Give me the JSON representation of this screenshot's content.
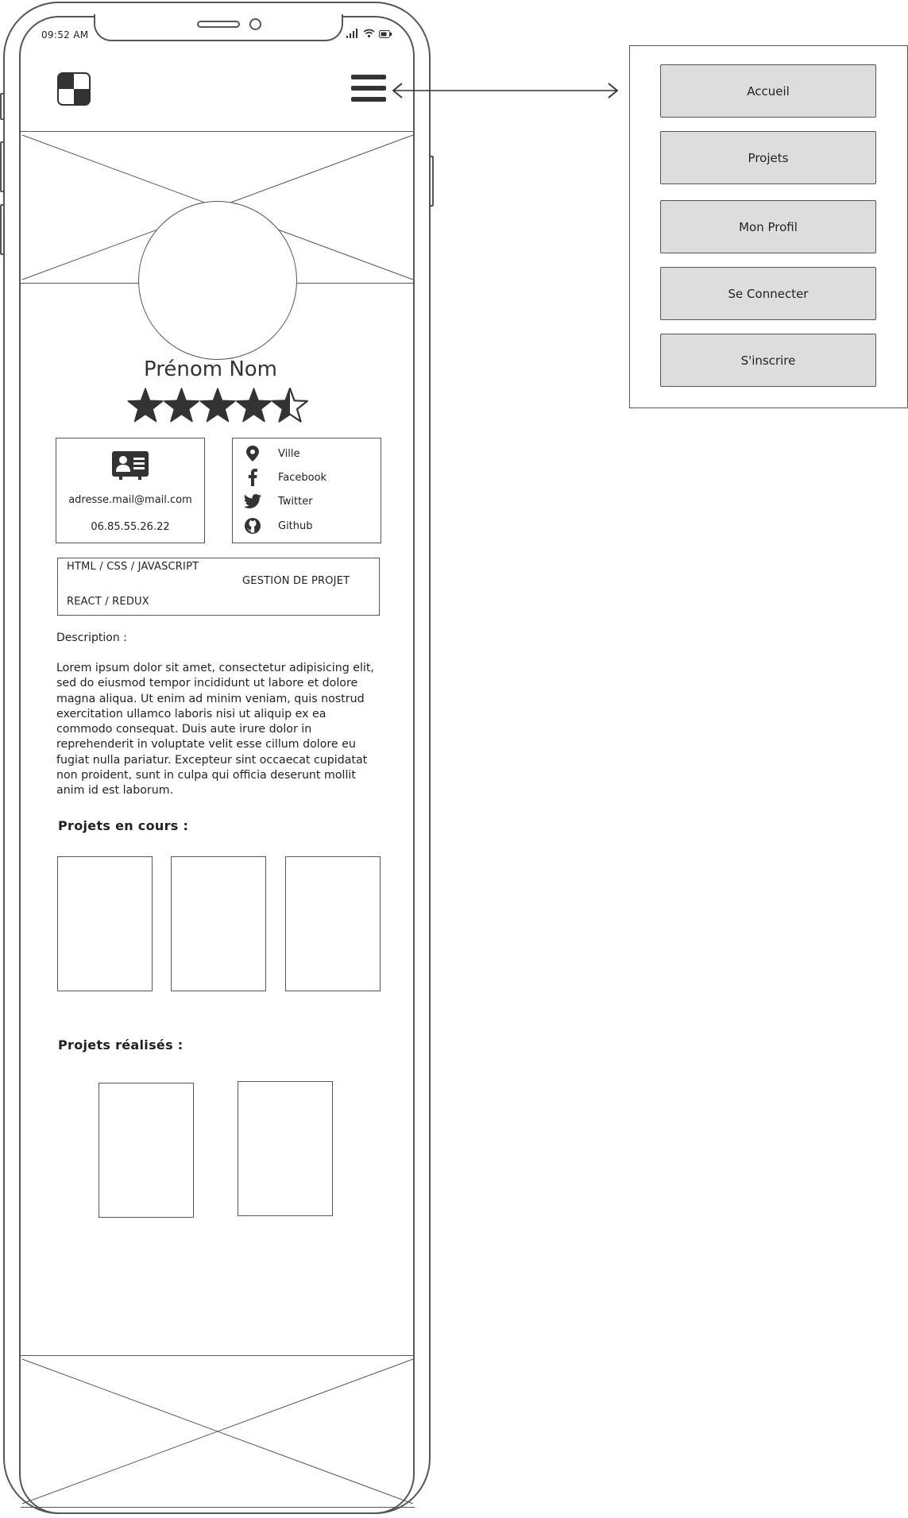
{
  "status_bar": {
    "time": "09:52 AM"
  },
  "profile": {
    "name": "Prénom Nom",
    "rating": 4.5,
    "rating_max": 5,
    "email": "adresse.mail@mail.com",
    "phone": "06.85.55.26.22"
  },
  "social": [
    {
      "icon": "location-pin-icon",
      "label": "Ville"
    },
    {
      "icon": "facebook-icon",
      "label": "Facebook"
    },
    {
      "icon": "twitter-icon",
      "label": "Twitter"
    },
    {
      "icon": "github-icon",
      "label": "Github"
    }
  ],
  "skills": [
    "HTML / CSS / JAVASCRIPT",
    "GESTION DE PROJET",
    "REACT / REDUX"
  ],
  "description": {
    "label": "Description :",
    "text": "Lorem ipsum dolor sit amet, consectetur adipisicing elit, sed do eiusmod tempor incididunt ut labore et dolore magna aliqua. Ut enim ad minim veniam, quis nostrud exercitation ullamco laboris nisi ut aliquip ex ea commodo consequat. Duis aute irure dolor in reprehenderit in voluptate velit esse cillum dolore eu fugiat nulla pariatur. Excepteur sint occaecat cupidatat non proident, sunt in culpa qui officia deserunt mollit anim id est laborum."
  },
  "projects_in_progress": {
    "title": "Projets en cours :"
  },
  "projects_done": {
    "title": "Projets réalisés :"
  },
  "menu": {
    "items": [
      "Accueil",
      "Projets",
      "Mon Profil",
      "Se Connecter",
      "S'inscrire"
    ]
  },
  "colors": {
    "stroke": "#555555",
    "button_fill": "#dddddd",
    "icon": "#333333"
  }
}
